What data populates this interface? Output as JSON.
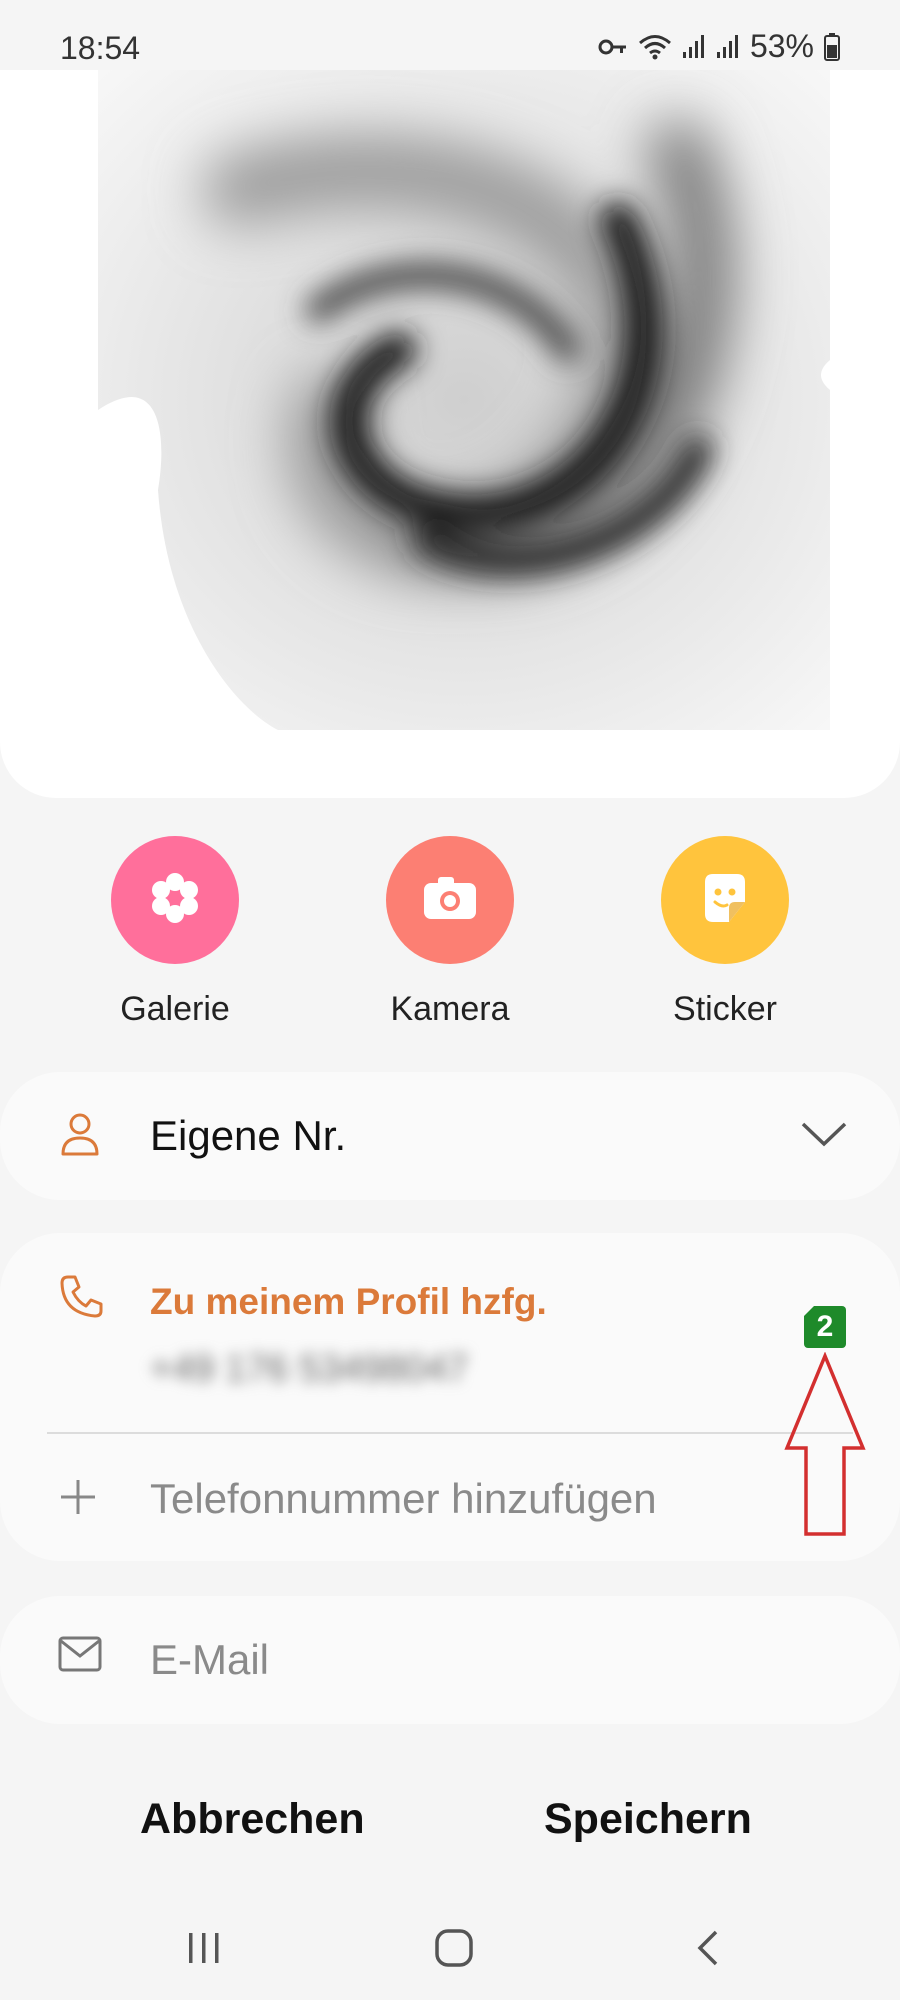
{
  "status_bar": {
    "time": "18:54",
    "battery": "53%",
    "icons": [
      "key-icon",
      "wifi-icon",
      "signal-icon",
      "signal-icon",
      "battery-icon"
    ]
  },
  "picture_options": [
    {
      "label": "Galerie",
      "icon": "flower-icon",
      "color": "#ff6f9b"
    },
    {
      "label": "Kamera",
      "icon": "camera-icon",
      "color": "#fc7f73"
    },
    {
      "label": "Sticker",
      "icon": "sticker-icon",
      "color": "#ffc43d"
    }
  ],
  "account": {
    "label": "Eigene Nr.",
    "icon": "person-icon"
  },
  "phone": {
    "header": "Zu meinem Profil hzfg.",
    "number_obscured": "+49 176 53498047",
    "add_placeholder": "Telefonnummer hinzufügen",
    "sim_badge": "2"
  },
  "email": {
    "placeholder": "E-Mail",
    "icon": "mail-icon"
  },
  "actions": {
    "cancel": "Abbrechen",
    "save": "Speichern"
  },
  "colors": {
    "accent": "#db7a3a",
    "annotation_arrow": "#d32f2f",
    "sim_badge": "#1e8a2a"
  },
  "nav_bar": [
    "recent-apps-icon",
    "home-icon",
    "back-icon"
  ]
}
